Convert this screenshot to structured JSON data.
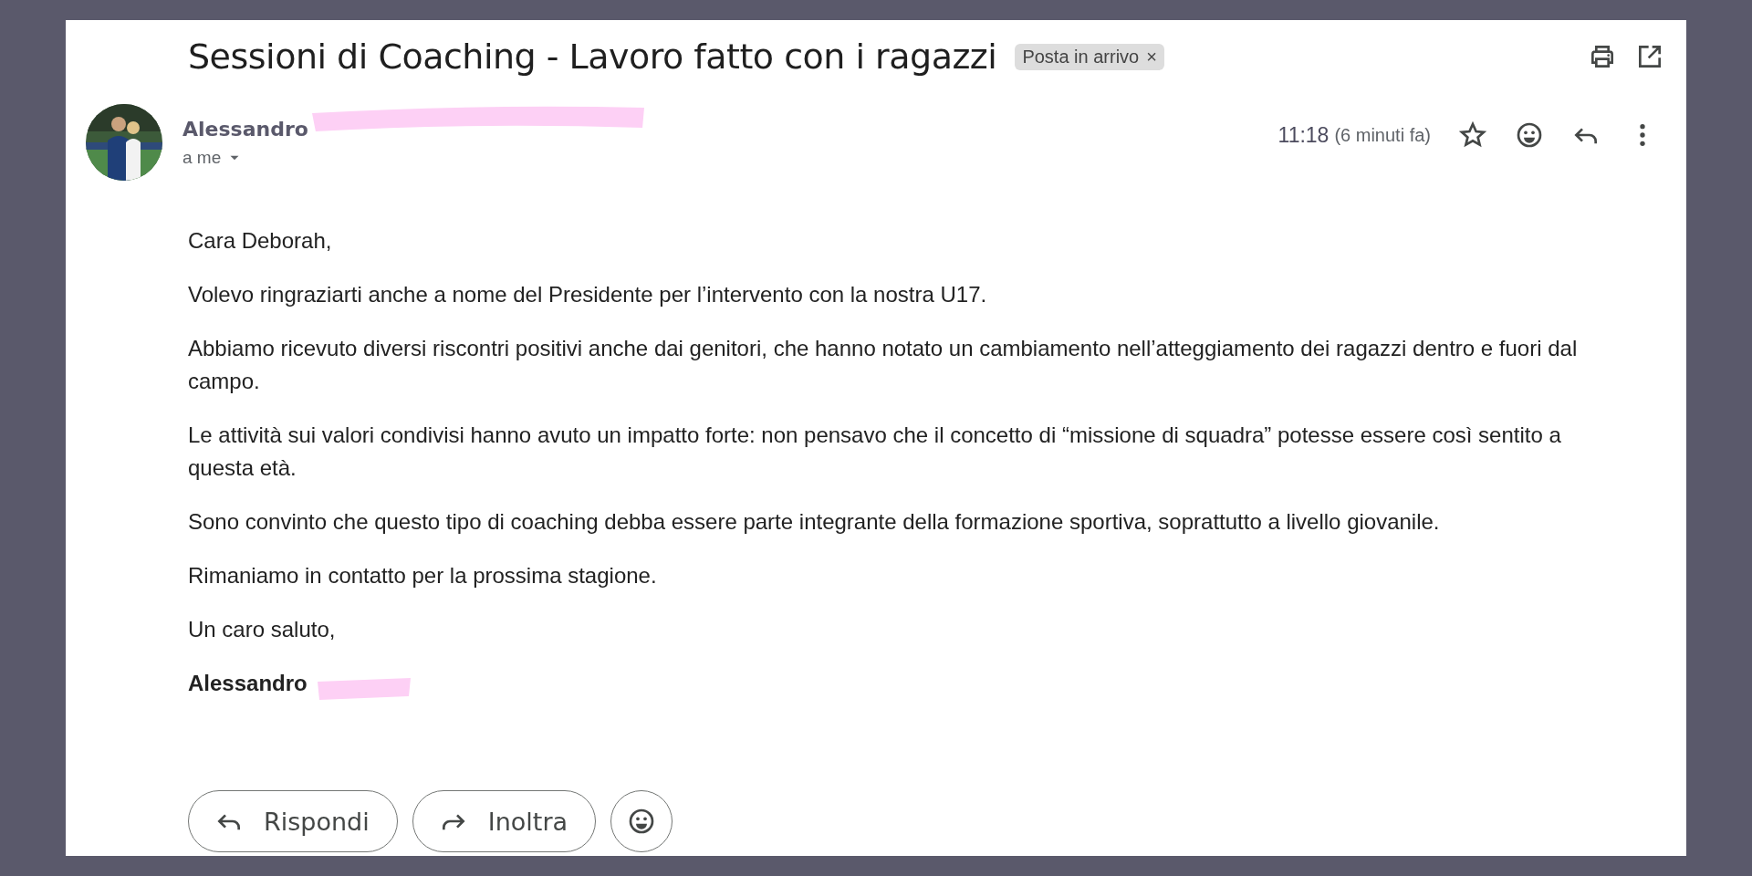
{
  "email": {
    "subject": "Sessioni di Coaching - Lavoro fatto con i ragazzi",
    "label": "Posta in arrivo",
    "label_close": "×"
  },
  "sender": {
    "name": "Alessandro",
    "recipient": "a me",
    "time": "11:18",
    "ago": "(6 minuti fa)",
    "starred": false
  },
  "body": [
    "Cara Deborah,",
    "Volevo ringraziarti anche a nome del Presidente per l’intervento con la nostra U17.",
    "Abbiamo ricevuto diversi riscontri positivi anche dai genitori, che hanno notato un cambiamento nell’atteggiamento dei ragazzi dentro e fuori dal campo.",
    "Le attività sui valori condivisi hanno avuto un impatto forte: non pensavo che il concetto di “missione di squadra” potesse essere così sentito a questa età.",
    "Sono convinto che questo tipo di coaching debba essere parte integrante della formazione sportiva, soprattutto a livello giovanile.",
    "Rimaniamo in contatto per la prossima stagione.",
    "Un caro saluto,"
  ],
  "signature": "Alessandro",
  "actions": [
    {
      "kind": "reply",
      "label": "Rispondi"
    },
    {
      "kind": "forward",
      "label": "Inoltra"
    },
    {
      "kind": "emoji"
    }
  ]
}
